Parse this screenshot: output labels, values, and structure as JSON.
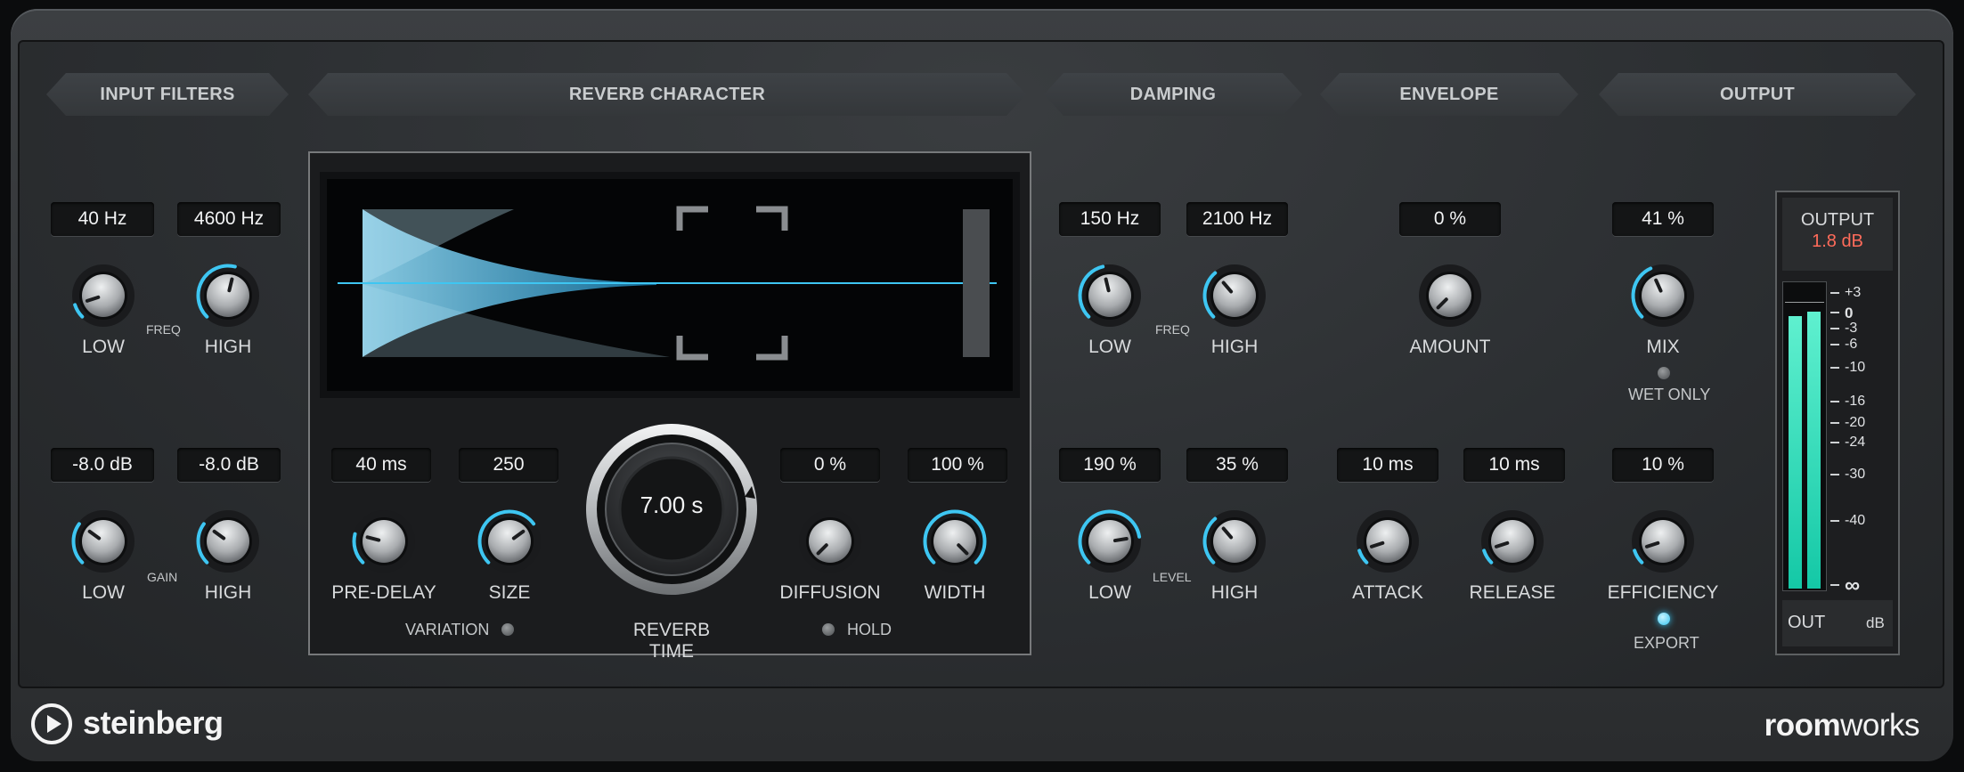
{
  "sections": {
    "input_filters": "INPUT FILTERS",
    "reverb_character": "REVERB CHARACTER",
    "damping": "DAMPING",
    "envelope": "ENVELOPE",
    "output": "OUTPUT"
  },
  "input_filters": {
    "freq_low": {
      "value": "40 Hz",
      "label": "LOW",
      "level": 0.1
    },
    "freq_high": {
      "value": "4600 Hz",
      "label": "HIGH",
      "level": 0.55
    },
    "freq_label": "FREQ",
    "gain_low": {
      "value": "-8.0 dB",
      "label": "LOW",
      "level": 0.3
    },
    "gain_high": {
      "value": "-8.0 dB",
      "label": "HIGH",
      "level": 0.3
    },
    "gain_label": "GAIN"
  },
  "reverb_character": {
    "pre_delay": {
      "value": "40 ms",
      "label": "PRE-DELAY",
      "level": 0.22
    },
    "size": {
      "value": "250",
      "label": "SIZE",
      "level": 0.7
    },
    "reverb_time": {
      "value": "7.00 s",
      "label": "REVERB TIME",
      "level": 0.9
    },
    "diffusion": {
      "value": "0 %",
      "label": "DIFFUSION",
      "level": 0.0
    },
    "width": {
      "value": "100 %",
      "label": "WIDTH",
      "level": 1.0
    },
    "variation_label": "VARIATION",
    "hold_label": "HOLD"
  },
  "damping": {
    "freq_low": {
      "value": "150 Hz",
      "label": "LOW",
      "level": 0.45
    },
    "freq_high": {
      "value": "2100 Hz",
      "label": "HIGH",
      "level": 0.35
    },
    "freq_label": "FREQ",
    "level_low": {
      "value": "190 %",
      "label": "LOW",
      "level": 0.8
    },
    "level_high": {
      "value": "35 %",
      "label": "HIGH",
      "level": 0.35
    },
    "level_label": "LEVEL"
  },
  "envelope": {
    "amount": {
      "value": "0 %",
      "label": "AMOUNT",
      "level": 0.0
    },
    "attack": {
      "value": "10 ms",
      "label": "ATTACK",
      "level": 0.1
    },
    "release": {
      "value": "10 ms",
      "label": "RELEASE",
      "level": 0.1
    }
  },
  "output": {
    "mix": {
      "value": "41 %",
      "label": "MIX",
      "level": 0.41
    },
    "wet_only_label": "WET ONLY",
    "efficiency": {
      "value": "10 %",
      "label": "EFFICIENCY",
      "level": 0.1
    },
    "export_label": "EXPORT",
    "meter": {
      "title": "OUTPUT",
      "value": "1.8 dB",
      "out_label": "OUT",
      "unit_label": "dB",
      "scale": [
        "+3",
        "0",
        "-3",
        "-6",
        "-10",
        "-16",
        "-20",
        "-24",
        "-30",
        "-40",
        "∞"
      ],
      "level_left": 0.895,
      "level_right": 0.908
    }
  },
  "brand": {
    "logo": "steinberg",
    "product_bold": "room",
    "product_light": "works"
  },
  "colors": {
    "accent": "#3ec6f2",
    "meter": "#1fd9b5",
    "peak": "#ff6b5a"
  }
}
